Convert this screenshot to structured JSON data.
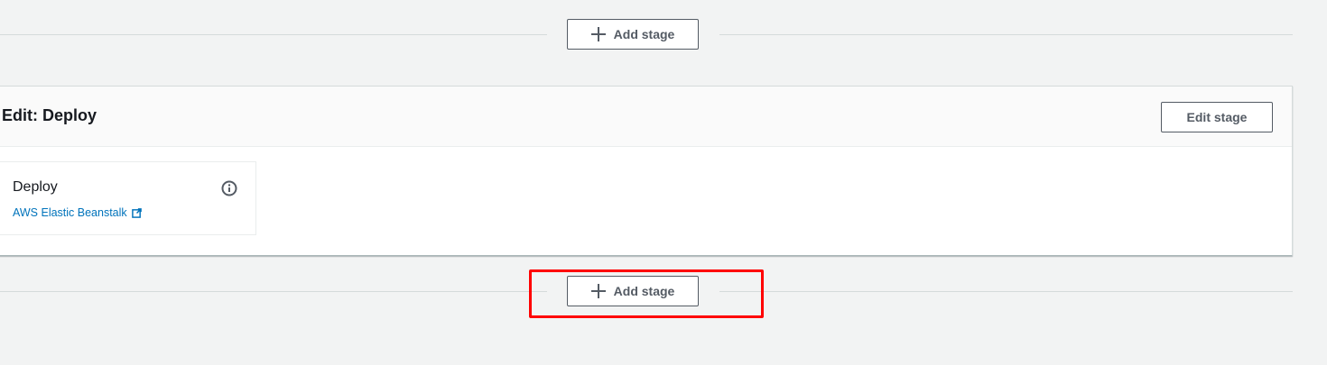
{
  "top_add_stage": {
    "label": "Add stage"
  },
  "stage": {
    "title": "Edit: Deploy",
    "edit_button_label": "Edit stage",
    "action": {
      "name": "Deploy",
      "provider": "AWS Elastic Beanstalk"
    }
  },
  "bottom_add_stage": {
    "label": "Add stage"
  },
  "colors": {
    "background": "#f2f3f3",
    "link": "#0073bb",
    "button_text": "#545b64",
    "highlight": "#ff0000"
  },
  "icons": {
    "add": "plus-icon",
    "info": "info-icon",
    "external_link": "external-link-icon"
  }
}
